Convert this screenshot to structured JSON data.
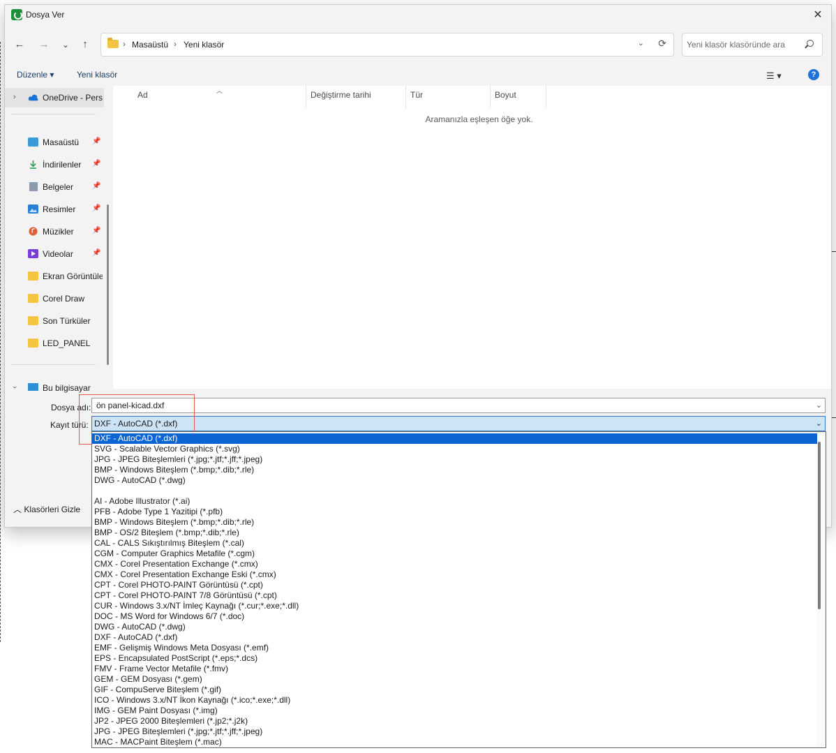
{
  "window": {
    "title": "Dosya Ver",
    "close": "✕"
  },
  "nav": {
    "back": "←",
    "forward": "→",
    "recent": "⌄",
    "up": "↑"
  },
  "address": {
    "crumbs": [
      "Masaüstü",
      "Yeni klasör"
    ],
    "sep": "›",
    "dropdown": "⌄",
    "refresh": "⟳"
  },
  "search": {
    "placeholder": "Yeni klasör klasöründe ara"
  },
  "commands": {
    "organize": "Düzenle ▾",
    "new_folder": "Yeni klasör",
    "view": "☰ ▾",
    "help": "?"
  },
  "sidebar": {
    "onedrive": "OneDrive - Perso",
    "pinned": [
      {
        "label": "Masaüstü",
        "icon": "desktop-icon",
        "color": "#3a9ad9"
      },
      {
        "label": "İndirilenler",
        "icon": "download-icon",
        "color": "#2e9e5b"
      },
      {
        "label": "Belgeler",
        "icon": "documents-icon",
        "color": "#6b7a8f"
      },
      {
        "label": "Resimler",
        "icon": "pictures-icon",
        "color": "#2a7fd4"
      },
      {
        "label": "Müzikler",
        "icon": "music-icon",
        "color": "#e0603a"
      },
      {
        "label": "Videolar",
        "icon": "videos-icon",
        "color": "#7a3fd6"
      }
    ],
    "folders": [
      "Ekran Görüntüleri",
      "Corel Draw",
      "Son Türküler",
      "LED_PANEL"
    ],
    "this_pc": "Bu bilgisayar"
  },
  "columns": [
    "Ad",
    "Değiştirme tarihi",
    "Tür",
    "Boyut"
  ],
  "empty_message": "Aramanızla eşleşen öğe yok.",
  "form": {
    "filename_label": "Dosya adı:",
    "filename_value": "ön panel-kicad.dxf",
    "filetype_label": "Kayıt türü:",
    "filetype_value": "DXF - AutoCAD (*.dxf)"
  },
  "hide_folders": "Klasörleri Gizle",
  "filetype_options": [
    "DXF - AutoCAD (*.dxf)",
    "SVG - Scalable Vector Graphics  (*.svg)",
    "JPG - JPEG Biteşlemleri (*.jpg;*.jtf;*.jff;*.jpeg)",
    "BMP - Windows Biteşlem (*.bmp;*.dib;*.rle)",
    "DWG - AutoCAD (*.dwg)",
    "",
    "AI - Adobe Illustrator (*.ai)",
    "PFB - Adobe Type 1 Yazitipi (*.pfb)",
    "BMP - Windows Biteşlem (*.bmp;*.dib;*.rle)",
    "BMP - OS/2 Biteşlem (*.bmp;*.dib;*.rle)",
    "CAL - CALS Sıkıştırılmış Biteşlem (*.cal)",
    "CGM - Computer Graphics Metafile (*.cgm)",
    "CMX - Corel Presentation Exchange (*.cmx)",
    "CMX - Corel Presentation Exchange Eski (*.cmx)",
    "CPT - Corel PHOTO-PAINT Görüntüsü (*.cpt)",
    "CPT - Corel PHOTO-PAINT 7/8 Görüntüsü (*.cpt)",
    "CUR - Windows 3.x/NT İmleç Kaynağı (*.cur;*.exe;*.dll)",
    "DOC - MS Word for Windows 6/7 (*.doc)",
    "DWG - AutoCAD (*.dwg)",
    "DXF - AutoCAD (*.dxf)",
    "EMF - Gelişmiş Windows Meta Dosyası (*.emf)",
    "EPS - Encapsulated PostScript (*.eps;*.dcs)",
    "FMV - Frame Vector Metafile (*.fmv)",
    "GEM - GEM Dosyası (*.gem)",
    "GIF - CompuServe Biteşlem (*.gif)",
    "ICO - Windows 3.x/NT İkon Kaynağı (*.ico;*.exe;*.dll)",
    "IMG - GEM Paint Dosyası (*.img)",
    "JP2 - JPEG 2000 Biteşlemleri (*.jp2;*.j2k)",
    "JPG - JPEG Biteşlemleri (*.jpg;*.jtf;*.jff;*.jpeg)",
    "MAC - MACPaint Biteşlem (*.mac)"
  ],
  "selected_option": 0,
  "colors": {
    "accent": "#0a64d2",
    "highlight_box": "#e0584f"
  }
}
